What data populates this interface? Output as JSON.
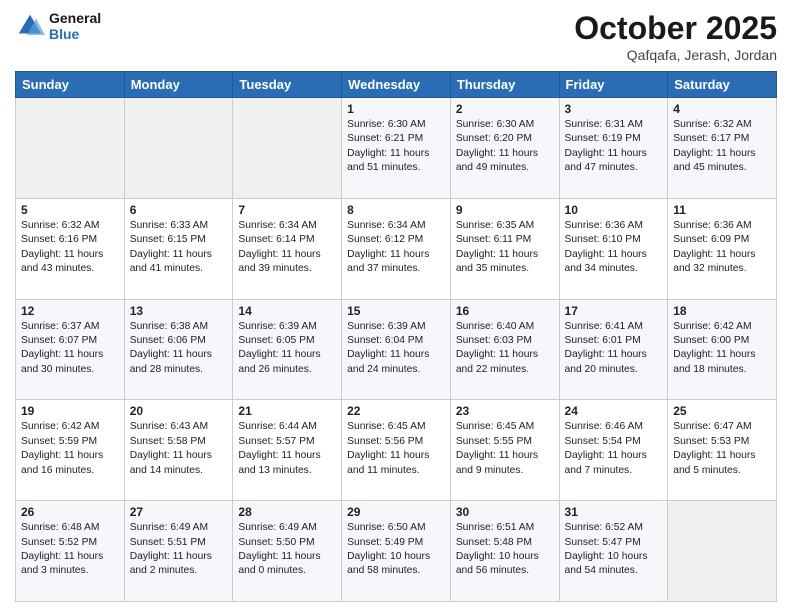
{
  "header": {
    "logo_line1": "General",
    "logo_line2": "Blue",
    "month": "October 2025",
    "location": "Qafqafa, Jerash, Jordan"
  },
  "weekdays": [
    "Sunday",
    "Monday",
    "Tuesday",
    "Wednesday",
    "Thursday",
    "Friday",
    "Saturday"
  ],
  "weeks": [
    [
      {
        "day": "",
        "info": ""
      },
      {
        "day": "",
        "info": ""
      },
      {
        "day": "",
        "info": ""
      },
      {
        "day": "1",
        "info": "Sunrise: 6:30 AM\nSunset: 6:21 PM\nDaylight: 11 hours\nand 51 minutes."
      },
      {
        "day": "2",
        "info": "Sunrise: 6:30 AM\nSunset: 6:20 PM\nDaylight: 11 hours\nand 49 minutes."
      },
      {
        "day": "3",
        "info": "Sunrise: 6:31 AM\nSunset: 6:19 PM\nDaylight: 11 hours\nand 47 minutes."
      },
      {
        "day": "4",
        "info": "Sunrise: 6:32 AM\nSunset: 6:17 PM\nDaylight: 11 hours\nand 45 minutes."
      }
    ],
    [
      {
        "day": "5",
        "info": "Sunrise: 6:32 AM\nSunset: 6:16 PM\nDaylight: 11 hours\nand 43 minutes."
      },
      {
        "day": "6",
        "info": "Sunrise: 6:33 AM\nSunset: 6:15 PM\nDaylight: 11 hours\nand 41 minutes."
      },
      {
        "day": "7",
        "info": "Sunrise: 6:34 AM\nSunset: 6:14 PM\nDaylight: 11 hours\nand 39 minutes."
      },
      {
        "day": "8",
        "info": "Sunrise: 6:34 AM\nSunset: 6:12 PM\nDaylight: 11 hours\nand 37 minutes."
      },
      {
        "day": "9",
        "info": "Sunrise: 6:35 AM\nSunset: 6:11 PM\nDaylight: 11 hours\nand 35 minutes."
      },
      {
        "day": "10",
        "info": "Sunrise: 6:36 AM\nSunset: 6:10 PM\nDaylight: 11 hours\nand 34 minutes."
      },
      {
        "day": "11",
        "info": "Sunrise: 6:36 AM\nSunset: 6:09 PM\nDaylight: 11 hours\nand 32 minutes."
      }
    ],
    [
      {
        "day": "12",
        "info": "Sunrise: 6:37 AM\nSunset: 6:07 PM\nDaylight: 11 hours\nand 30 minutes."
      },
      {
        "day": "13",
        "info": "Sunrise: 6:38 AM\nSunset: 6:06 PM\nDaylight: 11 hours\nand 28 minutes."
      },
      {
        "day": "14",
        "info": "Sunrise: 6:39 AM\nSunset: 6:05 PM\nDaylight: 11 hours\nand 26 minutes."
      },
      {
        "day": "15",
        "info": "Sunrise: 6:39 AM\nSunset: 6:04 PM\nDaylight: 11 hours\nand 24 minutes."
      },
      {
        "day": "16",
        "info": "Sunrise: 6:40 AM\nSunset: 6:03 PM\nDaylight: 11 hours\nand 22 minutes."
      },
      {
        "day": "17",
        "info": "Sunrise: 6:41 AM\nSunset: 6:01 PM\nDaylight: 11 hours\nand 20 minutes."
      },
      {
        "day": "18",
        "info": "Sunrise: 6:42 AM\nSunset: 6:00 PM\nDaylight: 11 hours\nand 18 minutes."
      }
    ],
    [
      {
        "day": "19",
        "info": "Sunrise: 6:42 AM\nSunset: 5:59 PM\nDaylight: 11 hours\nand 16 minutes."
      },
      {
        "day": "20",
        "info": "Sunrise: 6:43 AM\nSunset: 5:58 PM\nDaylight: 11 hours\nand 14 minutes."
      },
      {
        "day": "21",
        "info": "Sunrise: 6:44 AM\nSunset: 5:57 PM\nDaylight: 11 hours\nand 13 minutes."
      },
      {
        "day": "22",
        "info": "Sunrise: 6:45 AM\nSunset: 5:56 PM\nDaylight: 11 hours\nand 11 minutes."
      },
      {
        "day": "23",
        "info": "Sunrise: 6:45 AM\nSunset: 5:55 PM\nDaylight: 11 hours\nand 9 minutes."
      },
      {
        "day": "24",
        "info": "Sunrise: 6:46 AM\nSunset: 5:54 PM\nDaylight: 11 hours\nand 7 minutes."
      },
      {
        "day": "25",
        "info": "Sunrise: 6:47 AM\nSunset: 5:53 PM\nDaylight: 11 hours\nand 5 minutes."
      }
    ],
    [
      {
        "day": "26",
        "info": "Sunrise: 6:48 AM\nSunset: 5:52 PM\nDaylight: 11 hours\nand 3 minutes."
      },
      {
        "day": "27",
        "info": "Sunrise: 6:49 AM\nSunset: 5:51 PM\nDaylight: 11 hours\nand 2 minutes."
      },
      {
        "day": "28",
        "info": "Sunrise: 6:49 AM\nSunset: 5:50 PM\nDaylight: 11 hours\nand 0 minutes."
      },
      {
        "day": "29",
        "info": "Sunrise: 6:50 AM\nSunset: 5:49 PM\nDaylight: 10 hours\nand 58 minutes."
      },
      {
        "day": "30",
        "info": "Sunrise: 6:51 AM\nSunset: 5:48 PM\nDaylight: 10 hours\nand 56 minutes."
      },
      {
        "day": "31",
        "info": "Sunrise: 6:52 AM\nSunset: 5:47 PM\nDaylight: 10 hours\nand 54 minutes."
      },
      {
        "day": "",
        "info": ""
      }
    ]
  ]
}
